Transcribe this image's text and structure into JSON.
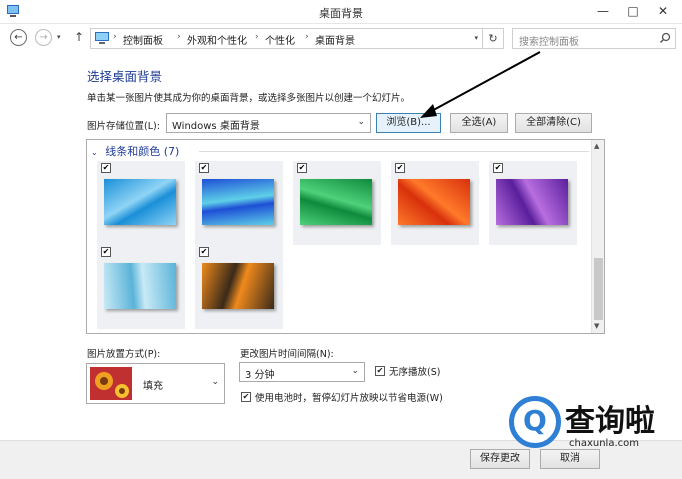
{
  "window": {
    "title": "桌面背景",
    "controls": {
      "minimize": "—",
      "maximize": "□",
      "close": "✕"
    }
  },
  "nav": {
    "back": "←",
    "forward": "→",
    "dropdown": "▾",
    "up": "↑",
    "breadcrumb": [
      "控制面板",
      "外观和个性化",
      "个性化",
      "桌面背景"
    ],
    "breadcrumb_sep": "›",
    "refresh": "↻",
    "search_placeholder": "搜索控制面板",
    "icons": [
      "back-icon",
      "forward-icon",
      "up-icon",
      "control-panel-icon",
      "refresh-icon",
      "search-icon"
    ]
  },
  "main": {
    "heading": "选择桌面背景",
    "subtitle": "单击某一张图片使其成为你的桌面背景，或选择多张图片以创建一个幻灯片。",
    "location_label": "图片存储位置(L):",
    "location_value": "Windows 桌面背景",
    "browse_button": "浏览(B)...",
    "select_all_button": "全选(A)",
    "clear_all_button": "全部清除(C)"
  },
  "gallery": {
    "group_chevron": "⌄",
    "group_title": "线条和颜色 (7)",
    "tiles": [
      {
        "checked": true,
        "colors": [
          "#1a8fd8",
          "#8fd4f5"
        ]
      },
      {
        "checked": true,
        "colors": [
          "#1e4fd6",
          "#5fd0e8"
        ]
      },
      {
        "checked": true,
        "colors": [
          "#0f8a3c",
          "#4ed17a"
        ]
      },
      {
        "checked": true,
        "colors": [
          "#d8300c",
          "#ff7a2a"
        ]
      },
      {
        "checked": true,
        "colors": [
          "#5a1f9c",
          "#b86ee0"
        ]
      },
      {
        "checked": true,
        "colors": [
          "#5ab3d8",
          "#c8eaf6"
        ]
      },
      {
        "checked": true,
        "colors": [
          "#3a2a1a",
          "#f08a1c"
        ]
      }
    ],
    "check_glyph": "✔",
    "scroll_up": "▲",
    "scroll_down": "▼"
  },
  "options": {
    "position_label": "图片放置方式(P):",
    "position_value": "填充",
    "interval_label": "更改图片时间间隔(N):",
    "interval_value": "3 分钟",
    "shuffle_label": "无序播放(S)",
    "shuffle_checked": true,
    "battery_label": "使用电池时，暂停幻灯片放映以节省电源(W)",
    "battery_checked": true
  },
  "footer": {
    "save_button": "保存更改",
    "cancel_button": "取消"
  },
  "watermark": {
    "mark": "Q",
    "brand": "查询啦",
    "url": "chaxunla.com"
  },
  "colors": {
    "accent": "#1e3c96",
    "browse_highlight": "#e5f1fb",
    "watermark_blue": "#2f7fd5"
  }
}
